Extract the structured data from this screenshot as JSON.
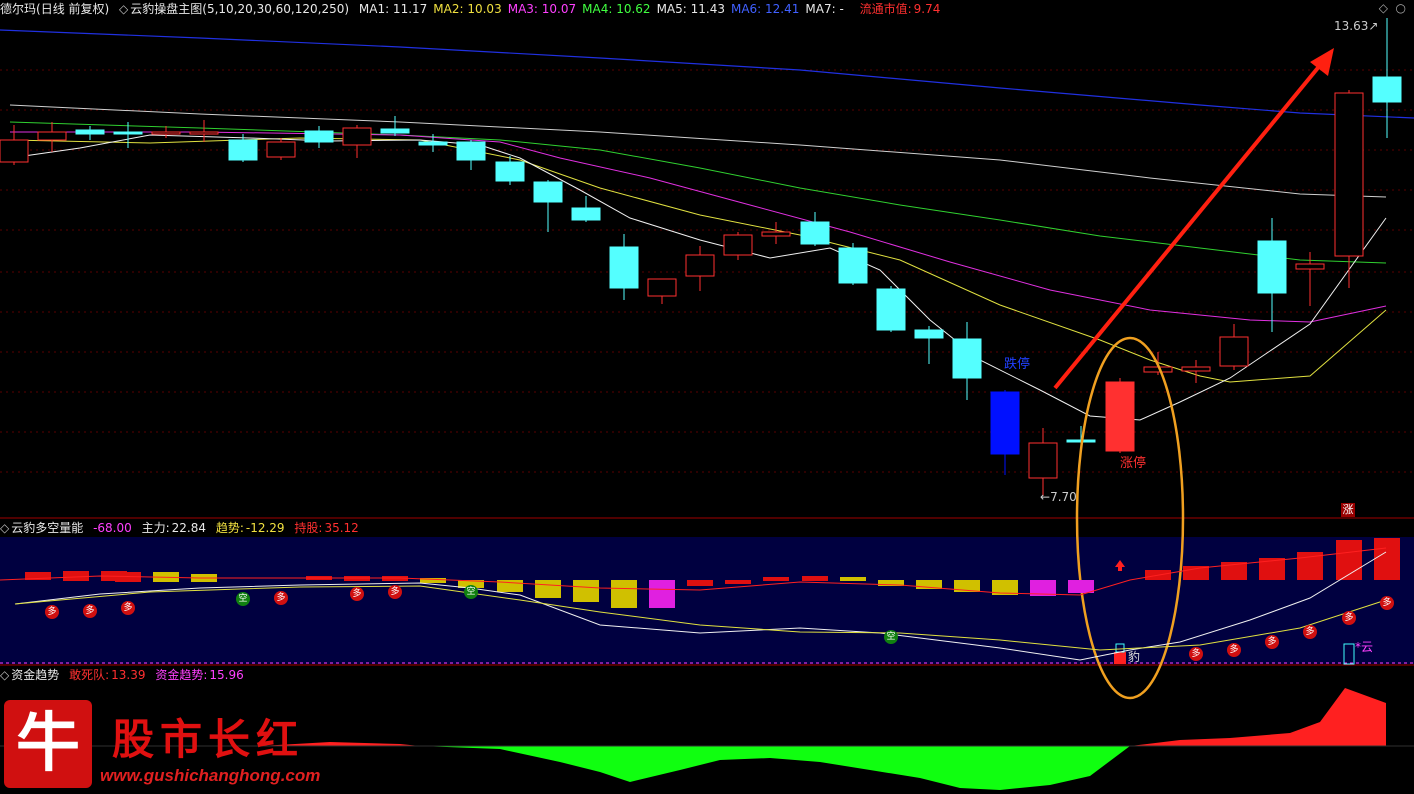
{
  "main_panel": {
    "stock_name": "德尔玛",
    "period": "(日线 前复权)",
    "indicator_title": "云豹操盘主图(5,10,20,30,60,120,250)",
    "ma": [
      {
        "label": "MA1:",
        "value": "11.17",
        "color": "#e8e8e8"
      },
      {
        "label": "MA2:",
        "value": "10.03",
        "color": "#f0e040"
      },
      {
        "label": "MA3:",
        "value": "10.07",
        "color": "#ff40ff"
      },
      {
        "label": "MA4:",
        "value": "10.62",
        "color": "#40ff40"
      },
      {
        "label": "MA5:",
        "value": "11.43",
        "color": "#e8e8e8"
      },
      {
        "label": "MA6:",
        "value": "12.41",
        "color": "#4060ff"
      },
      {
        "label": "MA7:",
        "value": "-",
        "color": "#e8e8e8"
      }
    ],
    "market_cap_label": "流通市值:",
    "market_cap_value": "9.74",
    "high_label": "13.63",
    "low_label": "7.70",
    "limit_down_label": "跌停",
    "limit_up_label": "涨停",
    "limit_up_badge": "涨"
  },
  "mid_panel": {
    "title": "云豹多空量能",
    "value0": "-68.00",
    "zhuli_label": "主力:",
    "zhuli_value": "22.84",
    "qushi_label": "趋势:",
    "qushi_value": "-12.29",
    "chigu_label": "持股:",
    "chigu_value": "35.12",
    "duo": "多",
    "kong": "空",
    "yun": "云",
    "bao": "豹"
  },
  "bottom_panel": {
    "title": "资金趋势",
    "gansidui_label": "敢死队:",
    "gansidui_value": "13.39",
    "zijinqushi_label": "资金趋势:",
    "zijinqushi_value": "15.96"
  },
  "watermark": {
    "logo_char": "牛",
    "name": "股市长红",
    "url": "www.gushichanghong.com"
  },
  "colors": {
    "up": "#ff3030",
    "down": "#54ffff",
    "down_limit": "#0010ff",
    "divider": "#a00000",
    "panel_bg": "#000040",
    "arrow": "#ff2010",
    "oval": "#f0a020"
  }
}
